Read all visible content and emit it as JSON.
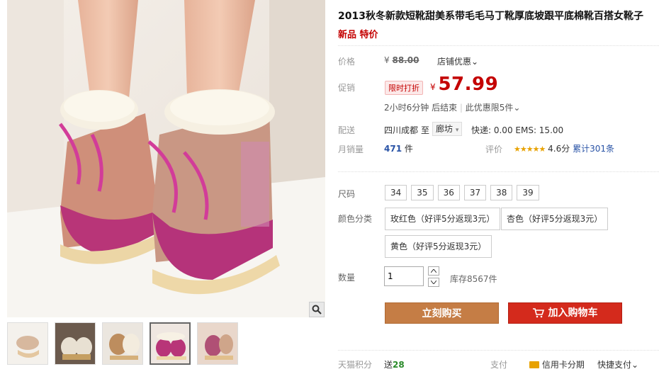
{
  "product": {
    "title": "2013秋冬新款短靴甜美系带毛毛马丁靴厚底坡跟平底棉靴百搭女靴子",
    "subtitle": "新品 特价"
  },
  "price": {
    "label": "价格",
    "currency": "¥",
    "original": "88.00",
    "shop_discount": "店铺优惠",
    "promo_label": "促销",
    "promo_tag": "限时打折",
    "current": "57.99",
    "countdown": "2小时6分钟 后结束",
    "limit": "此优惠限5件"
  },
  "shipping": {
    "label": "配送",
    "origin": "四川成都",
    "to": "至",
    "destination": "廊坊",
    "fee": "快递: 0.00 EMS: 15.00"
  },
  "sales": {
    "label": "月销量",
    "count": "471",
    "unit": "件",
    "rating_label": "评价",
    "stars": "★★★★★",
    "score": "4.6分",
    "reviews": "累计301条",
    "rating_fraction": 0.92
  },
  "options": {
    "size_label": "尺码",
    "sizes": [
      "34",
      "35",
      "36",
      "37",
      "38",
      "39"
    ],
    "color_label": "颜色分类",
    "colors": [
      "玫红色（好评5分返现3元）",
      "杏色（好评5分返现3元）",
      "黄色（好评5分返现3元）"
    ]
  },
  "quantity": {
    "label": "数量",
    "value": "1",
    "stock": "库存8567件"
  },
  "actions": {
    "buy_now": "立刻购买",
    "add_to_cart": "加入购物车"
  },
  "footer": {
    "points_label": "天猫积分",
    "points_prefix": "送",
    "points": "28",
    "pay_label": "支付",
    "credit": "信用卡分期",
    "quick_pay": "快捷支付"
  },
  "colors": {
    "accent_red": "#c40000",
    "buy_button": "#c57d45",
    "cart_button": "#d42a1c",
    "boot_pink": "#c0407e"
  }
}
